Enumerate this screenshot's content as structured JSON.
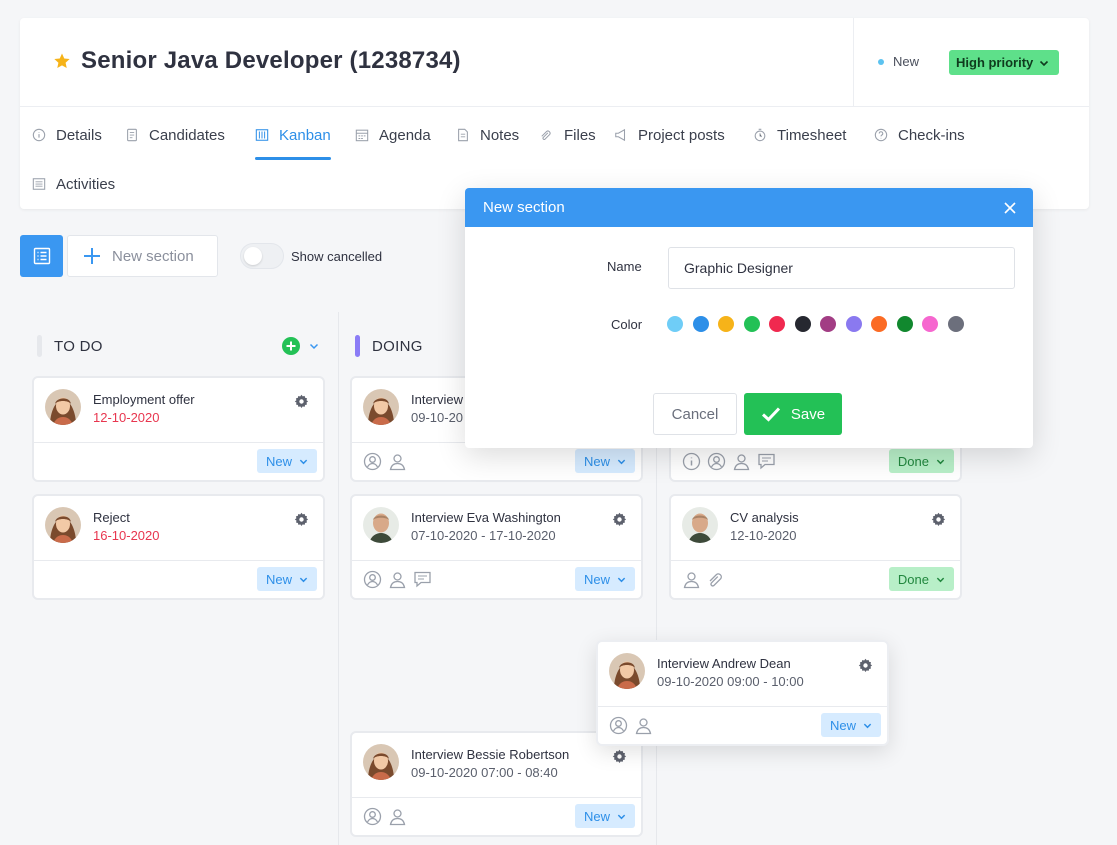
{
  "header": {
    "title": "Senior Java Developer (1238734)",
    "status": "New",
    "priority": "High priority"
  },
  "tabs": [
    {
      "label": "Details",
      "icon": "info-icon"
    },
    {
      "label": "Candidates",
      "icon": "document-icon"
    },
    {
      "label": "Kanban",
      "icon": "kanban-icon",
      "active": true
    },
    {
      "label": "Agenda",
      "icon": "calendar-icon"
    },
    {
      "label": "Notes",
      "icon": "note-icon"
    },
    {
      "label": "Files",
      "icon": "paperclip-icon"
    },
    {
      "label": "Project posts",
      "icon": "megaphone-icon"
    },
    {
      "label": "Timesheet",
      "icon": "stopwatch-icon"
    },
    {
      "label": "Check-ins",
      "icon": "question-icon"
    },
    {
      "label": "Activities",
      "icon": "list-icon"
    }
  ],
  "toolbar": {
    "new_section": "New section",
    "show_cancelled": "Show cancelled"
  },
  "columns": [
    {
      "title": "TO DO",
      "color": "#e6e8ec"
    },
    {
      "title": "DOING",
      "color": "#8b7cf6"
    }
  ],
  "cards": {
    "todo_1": {
      "title": "Employment offer",
      "date": "12-10-2020",
      "status": "New"
    },
    "todo_2": {
      "title": "Reject",
      "date": "16-10-2020",
      "status": "New"
    },
    "doing_1": {
      "title": "Interview",
      "date": "09-10-20",
      "status": "New"
    },
    "doing_2": {
      "title": "Interview Eva Washington",
      "date": "07-10-2020 - 17-10-2020",
      "status": "New"
    },
    "doing_3": {
      "title": "Interview Bessie Robertson",
      "date": "09-10-2020 07:00 - 08:40",
      "status": "New"
    },
    "done_1": {
      "status": "Done"
    },
    "done_2": {
      "title": "CV analysis",
      "date": "12-10-2020",
      "status": "Done"
    },
    "floating": {
      "title": "Interview Andrew Dean",
      "date": "09-10-2020 09:00 - 10:00",
      "status": "New"
    }
  },
  "modal": {
    "title": "New section",
    "name_label": "Name",
    "name_value": "Graphic Designer",
    "color_label": "Color",
    "colors": [
      "#6fcdf7",
      "#2d8fe8",
      "#f6b319",
      "#23c156",
      "#f0294f",
      "#262830",
      "#a23d84",
      "#8a79f0",
      "#fb6b24",
      "#11882e",
      "#f667cf",
      "#6c6f7c"
    ],
    "cancel": "Cancel",
    "save": "Save"
  }
}
